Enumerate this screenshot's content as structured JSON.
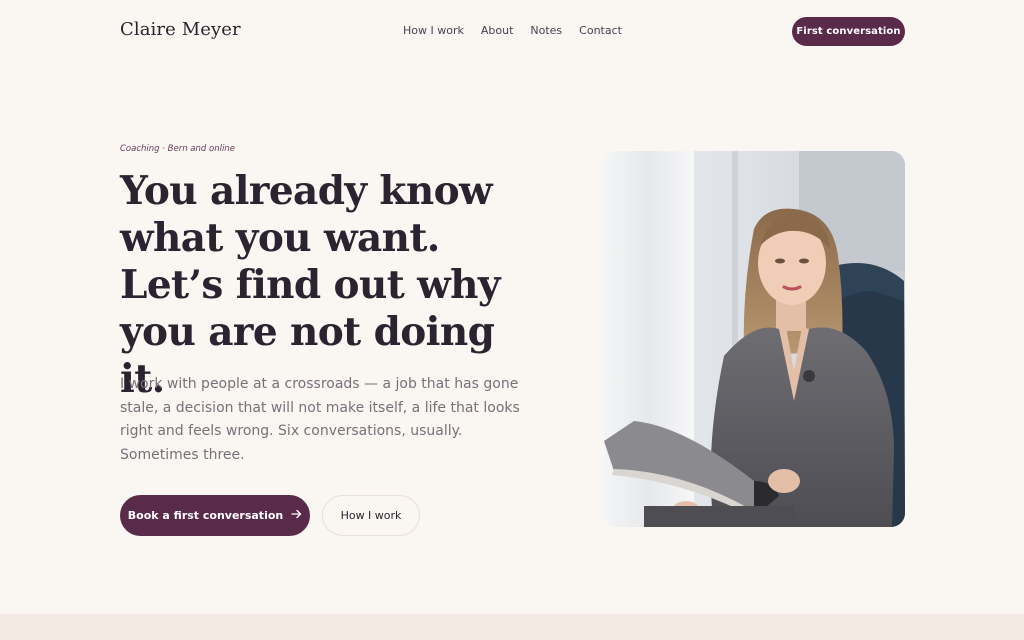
{
  "header": {
    "brand": "Claire Meyer",
    "nav": [
      "How I work",
      "About",
      "Notes",
      "Contact"
    ],
    "cta": "First conversation"
  },
  "hero": {
    "eyebrow": "Coaching · Bern and online",
    "headline": "You already know what you want. Let’s find out why you are not doing it.",
    "lede": "I work with people at a crossroads — a job that has gone stale, a decision that will not make itself, a life that looks right and feels wrong. Six conversations, usually. Sometimes three.",
    "primary_button": "Book a first conversation",
    "secondary_button": "How I work"
  },
  "colors": {
    "accent": "#5a2a4a",
    "background": "#faf6f2",
    "text": "#2b2430",
    "muted_text": "#7a7078"
  },
  "icons": {
    "arrow": "arrow-right-icon"
  }
}
